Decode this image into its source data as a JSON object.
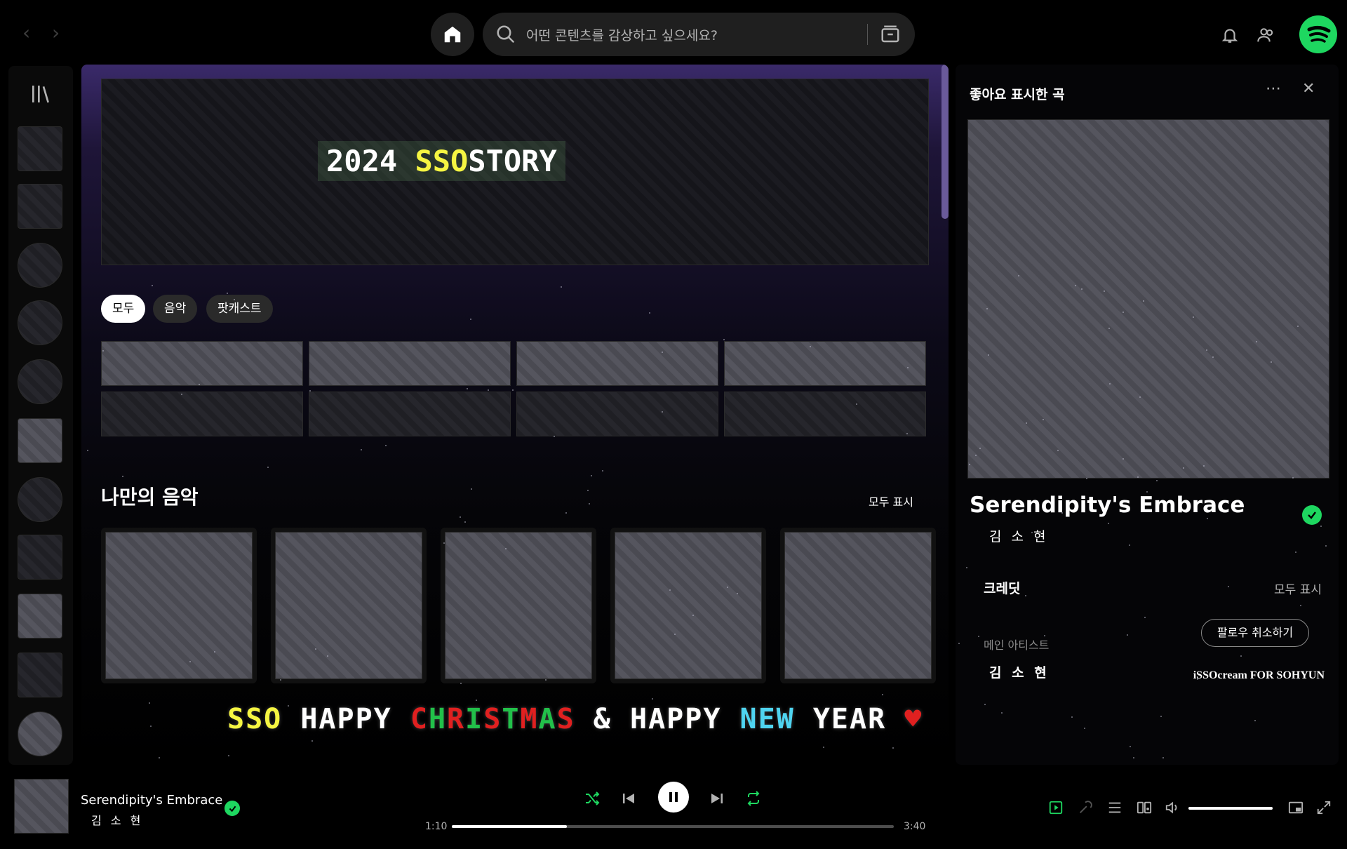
{
  "search": {
    "placeholder": "어떤 콘텐츠를 감상하고 싶으세요?"
  },
  "banner": {
    "text_prefix": "2024 ",
    "text_highlight": "SSO",
    "text_suffix": "STORY"
  },
  "filters": [
    "모두",
    "음악",
    "팟캐스트"
  ],
  "section": {
    "title": "나만의 음악",
    "show_all": "모두 표시"
  },
  "greeting": {
    "sso": "SSO",
    "happy1": "HAPPY",
    "christmas": [
      "C",
      "H",
      "R",
      "I",
      "S",
      "T",
      "M",
      "A",
      "S"
    ],
    "amp": "&",
    "happy2": "HAPPY",
    "new": "NEW",
    "year": "YEAR",
    "heart": "♥"
  },
  "colors": {
    "accent": "#1ed760",
    "yellow": "#f5f542",
    "red": "#e02020",
    "green": "#22c04a",
    "cyan": "#4fd4f0"
  },
  "panel": {
    "title": "좋아요 표시한 곡",
    "track_title": "Serendipity's Embrace",
    "artist": "김 소 현",
    "credits_title": "크레딧",
    "credits_show_all": "모두 표시",
    "main_artist_label": "메인 아티스트",
    "follow_button": "팔로우 취소하기",
    "artist_name": "김 소 현",
    "credit_line": "iSSOcream FOR SOHYUN"
  },
  "player": {
    "title": "Serendipity's Embrace",
    "artist": "김 소 현",
    "time_current": "1:10",
    "time_total": "3:40",
    "progress": 0.26,
    "volume": 1.0
  }
}
